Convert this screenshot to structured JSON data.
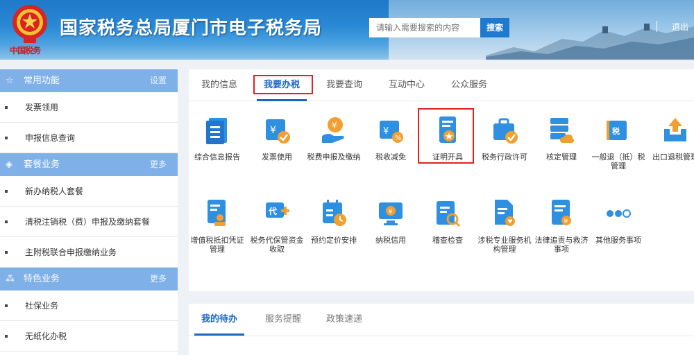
{
  "header": {
    "site_title": "国家税务总局厦门市电子税务局",
    "emblem_caption": "中国税务",
    "search_placeholder": "请输入需要搜索的内容",
    "search_button": "搜索",
    "logout": "退出"
  },
  "sidebar": {
    "sections": [
      {
        "title": "常用功能",
        "action": "设置",
        "icon": "star-icon",
        "items": [
          "发票领用",
          "申报信息查询"
        ]
      },
      {
        "title": "套餐业务",
        "action": "更多",
        "icon": "layers-icon",
        "items": [
          "新办纳税人套餐",
          "清税注销税（费）申报及缴纳套餐",
          "主附税联合申报缴纳业务"
        ]
      },
      {
        "title": "特色业务",
        "action": "更多",
        "icon": "grid-icon",
        "items": [
          "社保业务",
          "无纸化办税"
        ]
      }
    ]
  },
  "main": {
    "tabs": [
      "我的信息",
      "我要办税",
      "我要查询",
      "互动中心",
      "公众服务"
    ],
    "active_tab": "我要办税",
    "services_row1": [
      {
        "label": "综合信息报告",
        "icon": "report-doc-icon"
      },
      {
        "label": "发票使用",
        "icon": "invoice-check-icon"
      },
      {
        "label": "税费申报及缴纳",
        "icon": "hand-coin-icon"
      },
      {
        "label": "税收减免",
        "icon": "tax-reduction-icon"
      },
      {
        "label": "证明开具",
        "icon": "certificate-icon"
      },
      {
        "label": "税务行政许可",
        "icon": "briefcase-check-icon"
      },
      {
        "label": "核定管理",
        "icon": "server-cloud-icon"
      },
      {
        "label": "一般退（抵）税管理",
        "icon": "tax-refund-icon"
      },
      {
        "label": "出口退税管理",
        "icon": "upload-tray-icon"
      }
    ],
    "services_row2": [
      {
        "label": "增值税抵扣凭证管理",
        "icon": "doc-stamp-icon"
      },
      {
        "label": "税务代保管资金收取",
        "icon": "agent-card-icon"
      },
      {
        "label": "预约定价安排",
        "icon": "calendar-clock-icon"
      },
      {
        "label": "纳税信用",
        "icon": "monitor-coin-icon"
      },
      {
        "label": "稽查检查",
        "icon": "clipboard-search-icon"
      },
      {
        "label": "涉税专业服务机构管理",
        "icon": "doc-heart-icon"
      },
      {
        "label": "法律追责与救济事项",
        "icon": "doc-yen-icon"
      },
      {
        "label": "其他服务事项",
        "icon": "more-dots-icon"
      }
    ],
    "highlighted_service": "证明开具"
  },
  "bottom": {
    "tabs": [
      "我的待办",
      "服务提醒",
      "政策速递"
    ],
    "active_tab": "我的待办"
  },
  "colors": {
    "header_blue": "#1f78c8",
    "sidebar_head": "#7fb0e8",
    "active_blue": "#1a66c2",
    "highlight_red": "#e12020"
  }
}
